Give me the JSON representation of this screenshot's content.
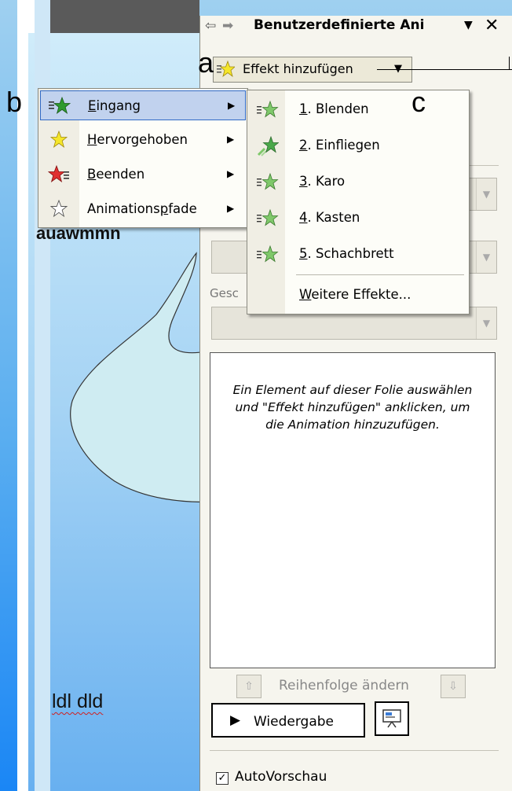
{
  "slide": {
    "text_top": "auawmmn",
    "text_bottom": "ldl dld"
  },
  "task_pane": {
    "title": "Benutzerdefinierte Ani",
    "back_icon": "back-arrow-icon",
    "forward_icon": "forward-arrow-icon",
    "add_effect_label": "Effekt hinzufügen",
    "dropdown3_label": "Gesc",
    "list_hint": "Ein Element auf dieser Folie auswählen und \"Effekt hinzufügen\" anklicken, um die Animation hinzuzufügen.",
    "reorder_label": "Reihenfolge ändern",
    "play_label": "Wiedergabe",
    "autopreview_label": "AutoVorschau",
    "autopreview_checked": true
  },
  "menu": {
    "items": [
      {
        "label": "Eingang",
        "accel": "E",
        "icon": "entrance-star-icon",
        "selected": true
      },
      {
        "label": "Hervorgehoben",
        "accel": "H",
        "icon": "emphasis-star-icon",
        "selected": false
      },
      {
        "label": "Beenden",
        "accel": "B",
        "icon": "exit-star-icon",
        "selected": false
      },
      {
        "label": "Animationspfade",
        "accel": "p",
        "icon": "motion-path-star-icon",
        "selected": false
      }
    ]
  },
  "submenu": {
    "items": [
      {
        "label": "1. Blenden",
        "icon": "entrance-effect-icon"
      },
      {
        "label": "2. Einfliegen",
        "icon": "fly-in-effect-icon"
      },
      {
        "label": "3. Karo",
        "icon": "entrance-effect-icon"
      },
      {
        "label": "4. Kasten",
        "icon": "entrance-effect-icon"
      },
      {
        "label": "5. Schachbrett",
        "icon": "entrance-effect-icon"
      }
    ],
    "more_label": "Weitere Effekte..."
  },
  "annotations": {
    "a": "a",
    "b": "b",
    "c": "c"
  },
  "colors": {
    "entrance": "#2e9a2e",
    "emphasis": "#f0e020",
    "exit": "#e03030",
    "highlight": "#c1d2ee",
    "slide_shape": "#cfecf2"
  }
}
